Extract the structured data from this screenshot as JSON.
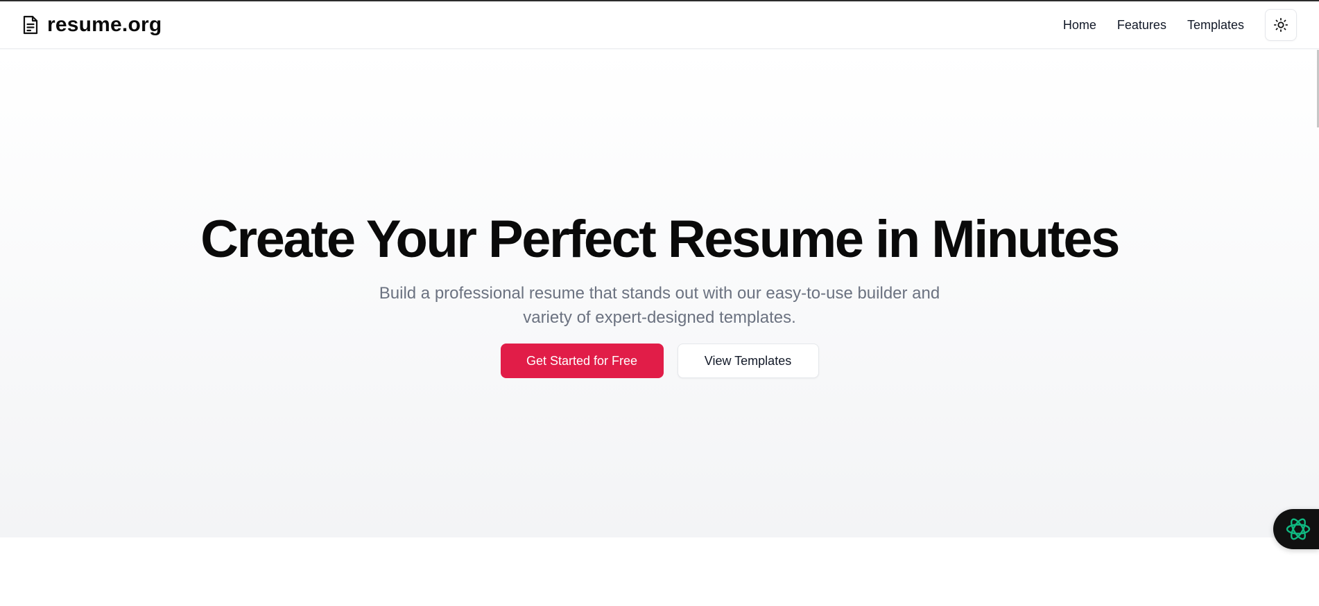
{
  "header": {
    "logo_icon": "document-icon",
    "brand": "resume.org",
    "nav": [
      {
        "label": "Home"
      },
      {
        "label": "Features"
      },
      {
        "label": "Templates"
      }
    ],
    "theme_toggle_icon": "sun-icon"
  },
  "hero": {
    "title": "Create Your Perfect Resume in Minutes",
    "subtitle": "Build a professional resume that stands out with our easy-to-use builder and variety of expert-designed templates.",
    "primary_button": "Get Started for Free",
    "secondary_button": "View Templates"
  },
  "assistant": {
    "icon": "openai-assistant-icon"
  },
  "colors": {
    "accent": "#e11d48",
    "assistant_icon": "#10b981",
    "subtitle_text": "#6b7280"
  }
}
